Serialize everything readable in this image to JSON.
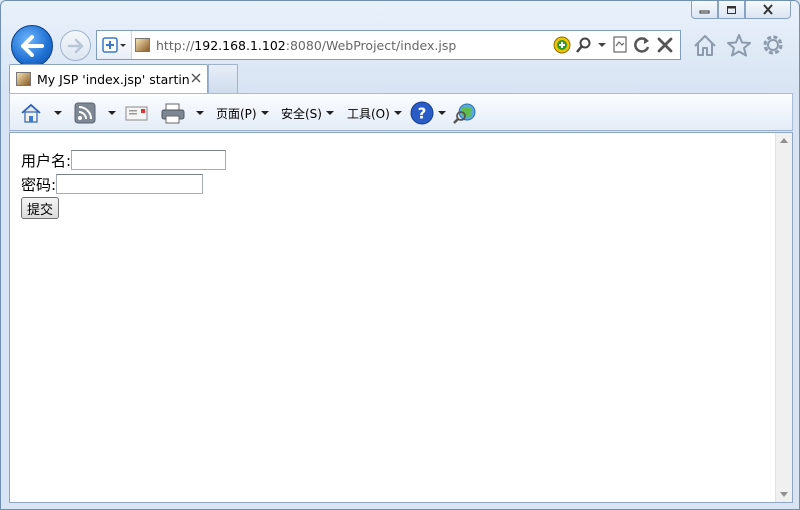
{
  "window": {
    "buttons": [
      "minimize",
      "maximize",
      "close"
    ]
  },
  "nav": {
    "back_icon": "back-arrow-icon",
    "forward_icon": "forward-arrow-icon",
    "address": {
      "url_scheme": "http://",
      "url_host": "192.168.1.102",
      "url_rest": ":8080/WebProject/index.jsp"
    },
    "right_icons": [
      "home-icon",
      "favorites-star-icon",
      "tools-gear-icon"
    ]
  },
  "tabs": [
    {
      "label": "My JSP 'index.jsp' startin..."
    }
  ],
  "command_bar": {
    "page_menu": "页面(P)",
    "safety_menu": "安全(S)",
    "tools_menu": "工具(O)"
  },
  "form": {
    "username_label": "用户名:",
    "username_value": "",
    "password_label": "密码:",
    "password_value": "",
    "submit_label": "提交"
  },
  "colors": {
    "back_button": "#1e6fd1",
    "frame": "#d8e4f3",
    "help_icon": "#2a5cc8"
  }
}
